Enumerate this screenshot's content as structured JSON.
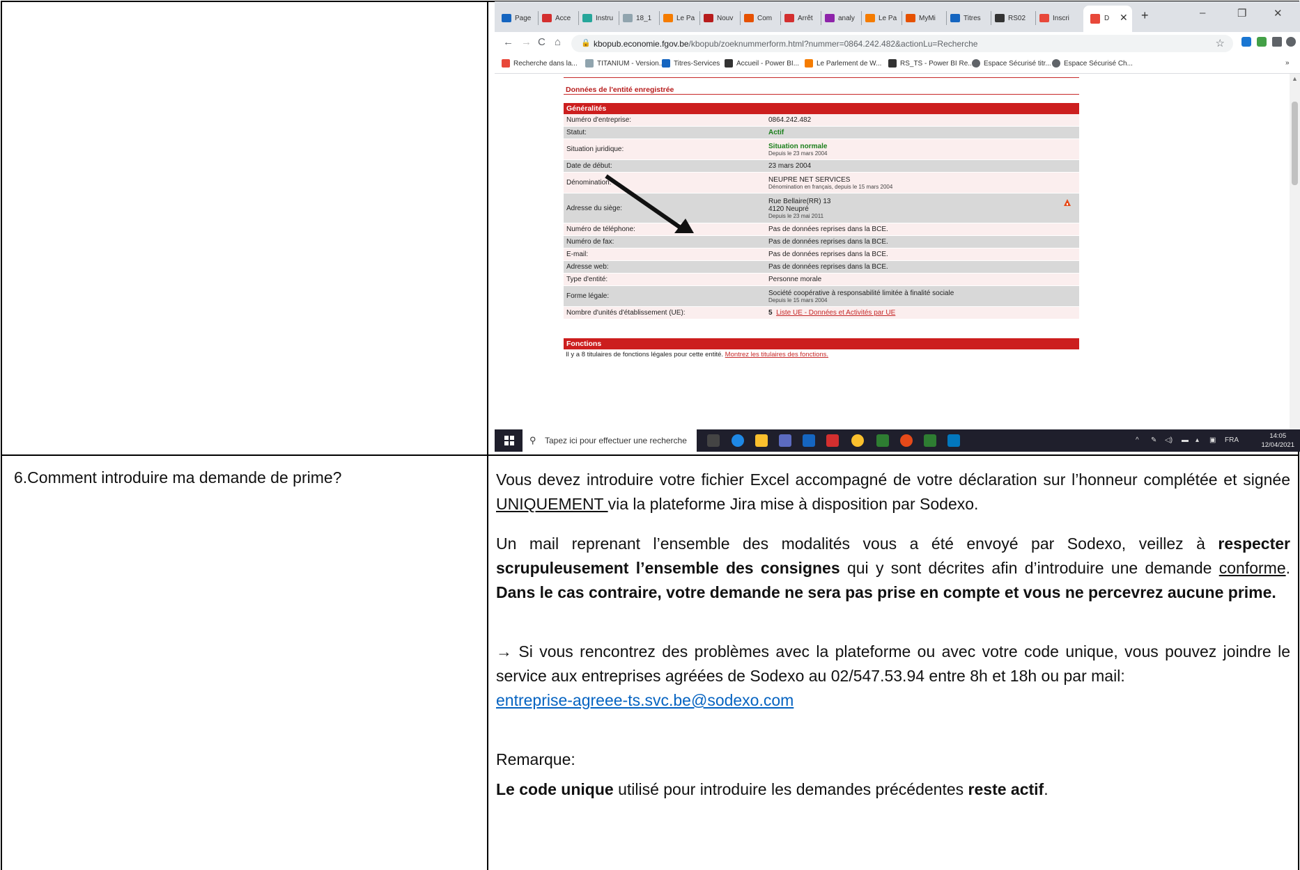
{
  "browser": {
    "tabs": [
      "Page",
      "Acce",
      "Instru",
      "18_1",
      "Le Pa",
      "Nouv",
      "Com",
      "Arrêt",
      "analy",
      "Le Pa",
      "MyMi",
      "Titres",
      "RS02",
      "Inscri"
    ],
    "active_tab": "D",
    "new_tab": "+",
    "window_controls": {
      "minimize": "–",
      "maximize": "❐",
      "close": "✕"
    },
    "nav": {
      "back": "←",
      "forward": "→",
      "reload": "C",
      "home": "⌂"
    },
    "url_host": "kbopub.economie.fgov.be",
    "url_rest": "/kbopub/zoeknummerform.html?nummer=0864.242.482&actionLu=Recherche",
    "bookmarks": [
      "Recherche dans la...",
      "TITANIUM - Version...",
      "Titres-Services",
      "Accueil - Power BI...",
      "Le Parlement de W...",
      "RS_TS - Power BI Re...",
      "Espace Sécurisé titr...",
      "Espace Sécurisé Ch..."
    ],
    "bookmarks_more": "»"
  },
  "kbo": {
    "section_title": "Données de l'entité enregistrée",
    "generalites_header": "Généralités",
    "rows": [
      {
        "k": "Numéro d'entreprise:",
        "v": "0864.242.482",
        "sub": ""
      },
      {
        "k": "Statut:",
        "v": "Actif",
        "sub": ""
      },
      {
        "k": "Situation juridique:",
        "v": "Situation normale",
        "sub": "Depuis le 23 mars 2004"
      },
      {
        "k": "Date de début:",
        "v": "23 mars 2004",
        "sub": ""
      },
      {
        "k": "Dénomination:",
        "v": "NEUPRE NET SERVICES",
        "sub": "Dénomination en français, depuis le 15 mars 2004"
      },
      {
        "k": "Adresse du siège:",
        "v": "Rue Bellaire(RR) 13",
        "v2": "4120 Neupré",
        "sub": "Depuis le 23 mai 2011"
      },
      {
        "k": "Numéro de téléphone:",
        "v": "Pas de données reprises dans la BCE.",
        "sub": ""
      },
      {
        "k": "Numéro de fax:",
        "v": "Pas de données reprises dans la BCE.",
        "sub": ""
      },
      {
        "k": "E-mail:",
        "v": "Pas de données reprises dans la BCE.",
        "sub": ""
      },
      {
        "k": "Adresse web:",
        "v": "Pas de données reprises dans la BCE.",
        "sub": ""
      },
      {
        "k": "Type d'entité:",
        "v": "Personne morale",
        "sub": ""
      },
      {
        "k": "Forme légale:",
        "v": "Société coopérative à responsabilité limitée à finalité sociale",
        "sub": "Depuis le 15 mars 2004"
      },
      {
        "k": "Nombre d'unités d'établissement (UE):",
        "v": "5",
        "link": "Liste UE - Données et Activités par UE",
        "sub": ""
      }
    ],
    "fonctions_header": "Fonctions",
    "fonctions_text": "Il y a 8 titulaires de fonctions légales pour cette entité.",
    "fonctions_link": "Montrez les titulaires des fonctions."
  },
  "taskbar": {
    "search_placeholder": "Tapez ici pour effectuer une recherche",
    "lang": "FRA",
    "time": "14:05",
    "date": "12/04/2021"
  },
  "doc": {
    "question": "6.Comment introduire ma demande de prime?",
    "p1_a": "Vous devez introduire votre fichier Excel accompagné de votre déclaration sur l’honneur complétée et signée ",
    "p1_u": "UNIQUEMENT ",
    "p1_b": "via la plateforme Jira mise à disposition par Sodexo.",
    "p2_a": "Un mail reprenant l’ensemble des modalités vous a été envoyé par Sodexo, veillez à ",
    "p2_bold1": "respecter scrupuleusement l’ensemble des consignes",
    "p2_b": " qui y sont décrites afin d’introduire une demande ",
    "p2_u": "conforme",
    "p2_c": ".  ",
    "p2_bold2": "Dans le cas contraire, votre demande ne sera pas prise en compte et vous ne percevrez aucune prime.",
    "p3_arrow": "→",
    "p3_text": " Si vous rencontrez des problèmes avec la plateforme ou avec votre code unique, vous pouvez joindre le service aux entreprises agréées de Sodexo au 02/547.53.94 entre 8h et 18h ou par mail:",
    "p3_email": "entreprise-agreee-ts.svc.be@sodexo.com",
    "remark_label": "Remarque:",
    "remark_bold1": "Le code unique",
    "remark_mid": " utilisé pour introduire les demandes précédentes ",
    "remark_bold2": "reste actif",
    "remark_end": "."
  },
  "colors": {
    "kbo_red": "#cc1e1e",
    "row_even": "#fbeeee",
    "row_odd": "#d8d8d8",
    "link_blue": "#0563c1"
  }
}
